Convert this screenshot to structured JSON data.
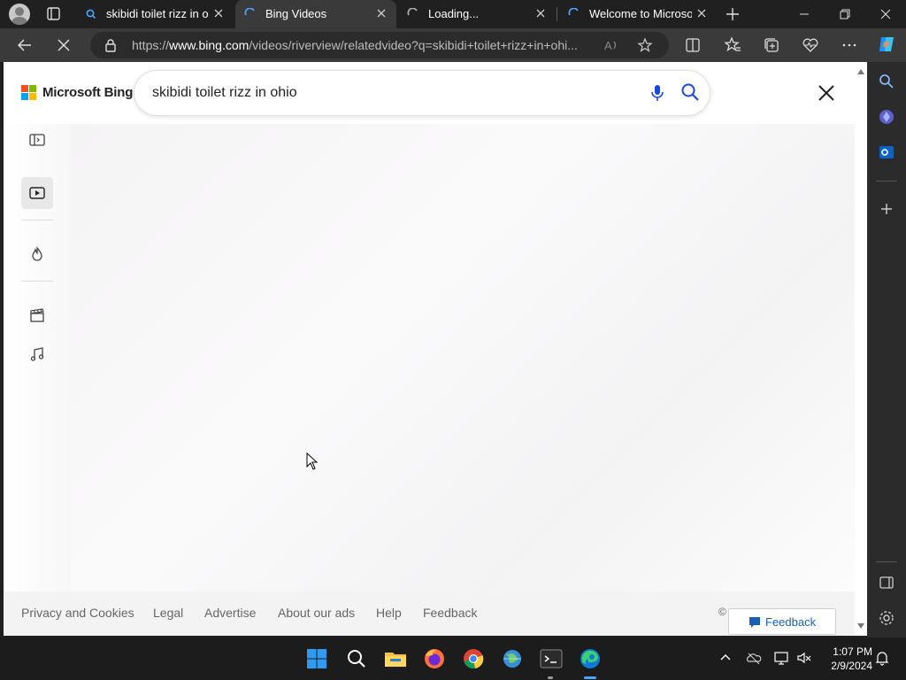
{
  "browser": {
    "tabs": [
      {
        "title": "skibidi toilet rizz in ohi",
        "active": false
      },
      {
        "title": "Bing Videos",
        "active": true
      },
      {
        "title": "Loading...",
        "active": false
      },
      {
        "title": "Welcome to Microsoft",
        "active": false
      }
    ],
    "url_prefix": "https://",
    "url_host": "www.bing.com",
    "url_path": "/videos/riverview/relatedvideo?q=skibidi+toilet+rizz+in+ohi..."
  },
  "page": {
    "brand": "Microsoft Bing",
    "search_query": "skibidi toilet rizz in ohio",
    "nav_icons": [
      "collapse-sidebar-icon",
      "video-icon",
      "trending-icon",
      "movies-icon",
      "music-icon"
    ],
    "footer_links": [
      "Privacy and Cookies",
      "Legal",
      "Advertise",
      "About our ads",
      "Help",
      "Feedback"
    ],
    "copyright": "©",
    "feedback_button": "Feedback"
  },
  "taskbar": {
    "time": "1:07 PM",
    "date": "2/9/2024"
  },
  "colors": {
    "accent": "#0078d4",
    "brand_red": "#f25022",
    "brand_green": "#7fba00",
    "brand_blue": "#00a4ef",
    "brand_yellow": "#ffb900"
  }
}
